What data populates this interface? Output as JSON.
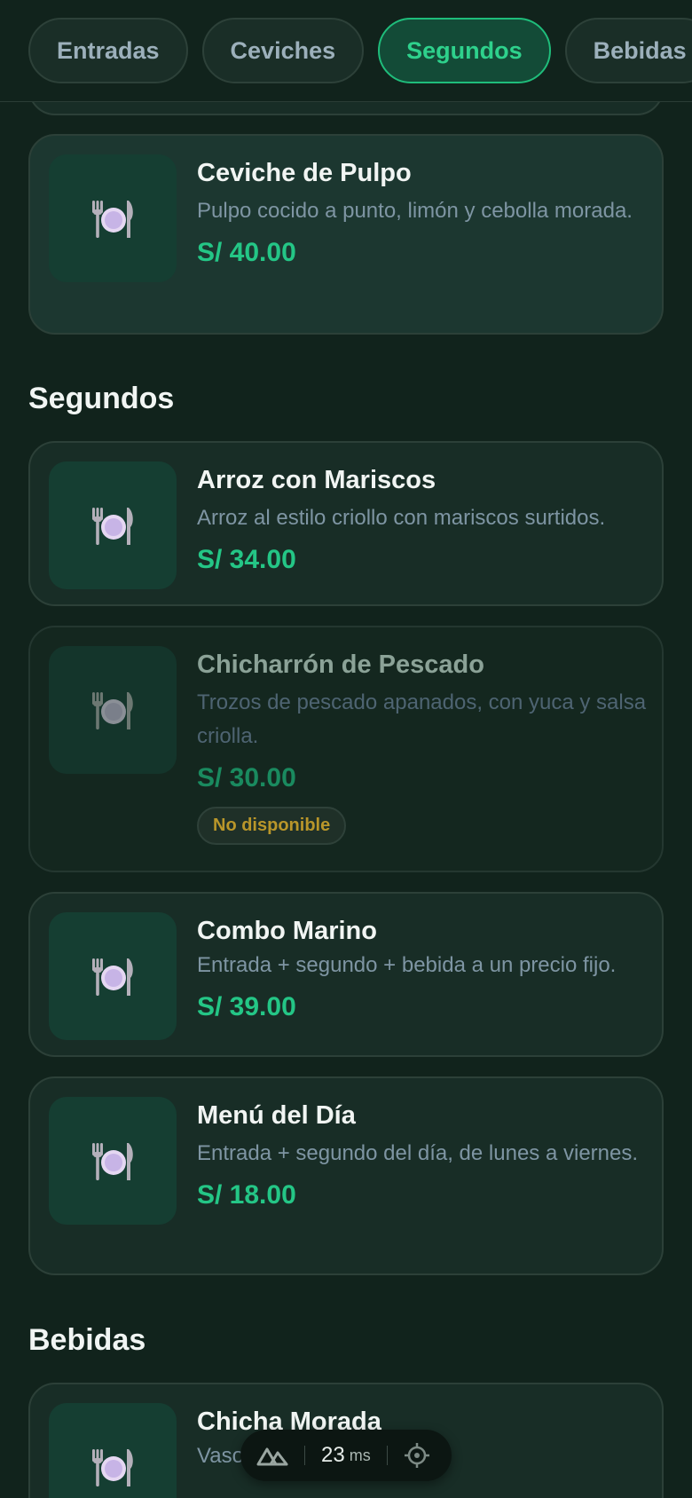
{
  "tabs": [
    {
      "label": "Entradas",
      "active": false
    },
    {
      "label": "Ceviches",
      "active": false
    },
    {
      "label": "Segundos",
      "active": true
    },
    {
      "label": "Bebidas",
      "active": false
    }
  ],
  "ceviches": {
    "item": {
      "name": "Ceviche de Pulpo",
      "desc": "Pulpo cocido a punto, limón y cebolla morada.",
      "price": "S/ 40.00"
    }
  },
  "segundos": {
    "title": "Segundos",
    "items": [
      {
        "name": "Arroz con Mariscos",
        "desc": "Arroz al estilo criollo con mariscos surtidos.",
        "price": "S/ 34.00"
      },
      {
        "name": "Chicharrón de Pescado",
        "desc": "Trozos de pescado apanados, con yuca y salsa criolla.",
        "price": "S/ 30.00",
        "badge": "No disponible"
      },
      {
        "name": "Combo Marino",
        "desc": "Entrada + segundo + bebida a un precio fijo.",
        "price": "S/ 39.00"
      },
      {
        "name": "Menú del Día",
        "desc": "Entrada + segundo del día, de lunes a viernes.",
        "price": "S/ 18.00"
      }
    ]
  },
  "bebidas": {
    "title": "Bebidas",
    "items": [
      {
        "name": "Chicha Morada",
        "desc": "Vaso"
      }
    ]
  },
  "perf": {
    "value": "23",
    "unit": "ms",
    "icon_logo": "nuxt-logo-icon",
    "icon_inspect": "crosshair-icon"
  },
  "colors": {
    "accent": "#24c686",
    "background": "#11231c",
    "card": "#182d26",
    "badge_text": "#b9962a"
  }
}
